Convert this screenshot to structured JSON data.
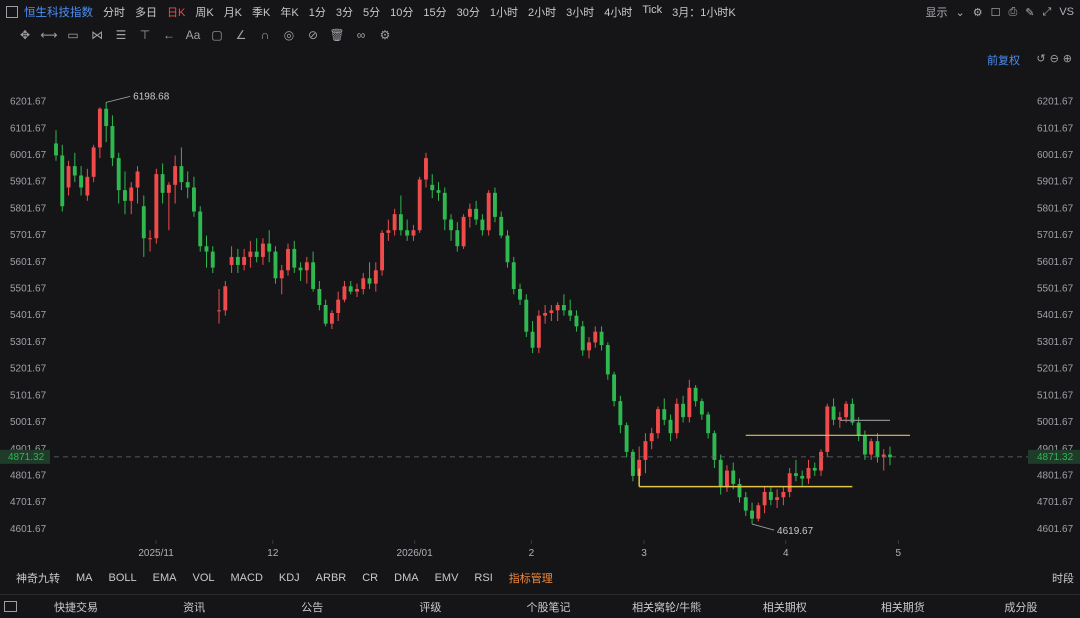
{
  "app": {
    "title": "恒生科技指数",
    "timeframes": [
      "分时",
      "多日",
      "日K",
      "周K",
      "月K",
      "季K",
      "年K",
      "1分",
      "3分",
      "5分",
      "10分",
      "15分",
      "30分",
      "1小时",
      "2小时",
      "3小时",
      "4小时",
      "Tick",
      "3月：1小时K"
    ],
    "active_timeframe": "日K",
    "display_label": "显示",
    "right_icons": [
      "gear-icon",
      "window-icon",
      "camera-icon",
      "pen-icon",
      "fullscreen-icon",
      "compare-icon"
    ],
    "compare_label": "VS"
  },
  "toolbar": {
    "tools": [
      "crosshair-icon",
      "line-icon",
      "rect-icon",
      "pattern-icon",
      "fib-icon",
      "vertical-icon",
      "arrow-icon",
      "text-icon",
      "comment-icon",
      "eraser-icon",
      "magnet-icon",
      "eye-icon",
      "lock-icon",
      "trash-icon",
      "link-icon",
      "settings-icon"
    ],
    "text_tool_label": "Aa"
  },
  "restore_label": "前复权",
  "chart_data": {
    "type": "candlestick",
    "ylim": [
      4560,
      6290
    ],
    "yticks": [
      6201.67,
      6101.67,
      6001.67,
      5901.67,
      5801.67,
      5701.67,
      5601.67,
      5501.67,
      5401.67,
      5301.67,
      5201.67,
      5101.67,
      5001.67,
      4901.67,
      4801.67,
      4701.67,
      4601.67
    ],
    "current_price": 4871.32,
    "current_price_label": "4871.32",
    "xlabels": [
      "2025/11",
      "12",
      "2026/01",
      "2",
      "3",
      "4",
      "5"
    ],
    "annotations": [
      {
        "text": "6198.68",
        "value": 6198.68
      },
      {
        "text": "4619.67",
        "value": 4619.67
      }
    ],
    "colors": {
      "up": "#ef4b4b",
      "down": "#2eb84f",
      "current": "#2eb84f",
      "level": "#e0c34a"
    },
    "candles": [
      [
        6045,
        6095,
        5980,
        6000
      ],
      [
        6000,
        6040,
        5790,
        5810
      ],
      [
        5880,
        5980,
        5850,
        5960
      ],
      [
        5960,
        6010,
        5900,
        5925
      ],
      [
        5925,
        5960,
        5850,
        5880
      ],
      [
        5850,
        5950,
        5830,
        5920
      ],
      [
        5920,
        6040,
        5900,
        6030
      ],
      [
        6030,
        6180,
        5990,
        6175
      ],
      [
        6175,
        6200,
        6050,
        6110
      ],
      [
        6110,
        6150,
        5960,
        5990
      ],
      [
        5990,
        6010,
        5820,
        5870
      ],
      [
        5870,
        5940,
        5780,
        5830
      ],
      [
        5830,
        5900,
        5780,
        5880
      ],
      [
        5880,
        5960,
        5820,
        5940
      ],
      [
        5810,
        5850,
        5620,
        5690
      ],
      [
        5690,
        5720,
        5640,
        5690
      ],
      [
        5690,
        5950,
        5670,
        5930
      ],
      [
        5930,
        5970,
        5820,
        5860
      ],
      [
        5860,
        5900,
        5720,
        5890
      ],
      [
        5890,
        6000,
        5820,
        5960
      ],
      [
        5960,
        6030,
        5870,
        5900
      ],
      [
        5900,
        5940,
        5840,
        5880
      ],
      [
        5880,
        5920,
        5770,
        5790
      ],
      [
        5790,
        5810,
        5640,
        5660
      ],
      [
        5660,
        5700,
        5580,
        5640
      ],
      [
        5640,
        5660,
        5560,
        5580
      ],
      [
        5420,
        5500,
        5370,
        5420
      ],
      [
        5420,
        5530,
        5400,
        5510
      ],
      [
        5590,
        5660,
        5560,
        5620
      ],
      [
        5620,
        5650,
        5560,
        5590
      ],
      [
        5590,
        5650,
        5570,
        5620
      ],
      [
        5620,
        5680,
        5580,
        5640
      ],
      [
        5640,
        5690,
        5600,
        5620
      ],
      [
        5620,
        5690,
        5590,
        5670
      ],
      [
        5670,
        5720,
        5600,
        5640
      ],
      [
        5640,
        5660,
        5520,
        5540
      ],
      [
        5540,
        5590,
        5480,
        5570
      ],
      [
        5570,
        5670,
        5550,
        5650
      ],
      [
        5650,
        5680,
        5560,
        5580
      ],
      [
        5580,
        5600,
        5530,
        5570
      ],
      [
        5570,
        5620,
        5520,
        5600
      ],
      [
        5600,
        5640,
        5490,
        5500
      ],
      [
        5500,
        5530,
        5420,
        5440
      ],
      [
        5440,
        5460,
        5360,
        5370
      ],
      [
        5370,
        5420,
        5350,
        5410
      ],
      [
        5410,
        5490,
        5380,
        5460
      ],
      [
        5460,
        5530,
        5450,
        5510
      ],
      [
        5510,
        5530,
        5480,
        5490
      ],
      [
        5490,
        5520,
        5470,
        5500
      ],
      [
        5500,
        5560,
        5480,
        5540
      ],
      [
        5540,
        5600,
        5500,
        5520
      ],
      [
        5520,
        5600,
        5490,
        5570
      ],
      [
        5570,
        5720,
        5550,
        5710
      ],
      [
        5710,
        5760,
        5680,
        5720
      ],
      [
        5720,
        5800,
        5700,
        5780
      ],
      [
        5780,
        5850,
        5700,
        5720
      ],
      [
        5720,
        5760,
        5680,
        5700
      ],
      [
        5700,
        5740,
        5680,
        5720
      ],
      [
        5720,
        5920,
        5710,
        5910
      ],
      [
        5910,
        6010,
        5880,
        5990
      ],
      [
        5890,
        5930,
        5840,
        5870
      ],
      [
        5870,
        5900,
        5830,
        5860
      ],
      [
        5860,
        5880,
        5720,
        5760
      ],
      [
        5760,
        5780,
        5680,
        5720
      ],
      [
        5720,
        5750,
        5640,
        5660
      ],
      [
        5660,
        5780,
        5650,
        5770
      ],
      [
        5770,
        5820,
        5730,
        5800
      ],
      [
        5800,
        5830,
        5740,
        5760
      ],
      [
        5760,
        5780,
        5700,
        5720
      ],
      [
        5720,
        5870,
        5700,
        5860
      ],
      [
        5860,
        5880,
        5750,
        5770
      ],
      [
        5770,
        5790,
        5690,
        5700
      ],
      [
        5700,
        5720,
        5580,
        5600
      ],
      [
        5600,
        5620,
        5480,
        5500
      ],
      [
        5500,
        5520,
        5440,
        5460
      ],
      [
        5460,
        5480,
        5320,
        5340
      ],
      [
        5340,
        5380,
        5260,
        5280
      ],
      [
        5280,
        5420,
        5260,
        5400
      ],
      [
        5400,
        5440,
        5370,
        5410
      ],
      [
        5410,
        5440,
        5380,
        5420
      ],
      [
        5420,
        5450,
        5380,
        5440
      ],
      [
        5440,
        5480,
        5400,
        5420
      ],
      [
        5420,
        5460,
        5380,
        5400
      ],
      [
        5400,
        5420,
        5340,
        5360
      ],
      [
        5360,
        5380,
        5250,
        5270
      ],
      [
        5270,
        5320,
        5240,
        5300
      ],
      [
        5300,
        5360,
        5280,
        5340
      ],
      [
        5340,
        5360,
        5270,
        5290
      ],
      [
        5290,
        5300,
        5160,
        5180
      ],
      [
        5180,
        5190,
        5060,
        5080
      ],
      [
        5080,
        5100,
        4960,
        4990
      ],
      [
        4990,
        5000,
        4870,
        4890
      ],
      [
        4890,
        4900,
        4780,
        4800
      ],
      [
        4800,
        4910,
        4780,
        4860
      ],
      [
        4860,
        4960,
        4810,
        4930
      ],
      [
        4930,
        4980,
        4900,
        4960
      ],
      [
        4960,
        5060,
        4940,
        5050
      ],
      [
        5050,
        5090,
        4990,
        5010
      ],
      [
        5010,
        5030,
        4930,
        4960
      ],
      [
        4960,
        5090,
        4940,
        5070
      ],
      [
        5070,
        5100,
        5000,
        5020
      ],
      [
        5020,
        5160,
        5000,
        5130
      ],
      [
        5130,
        5140,
        5060,
        5080
      ],
      [
        5080,
        5090,
        5010,
        5030
      ],
      [
        5030,
        5040,
        4940,
        4960
      ],
      [
        4960,
        4970,
        4830,
        4860
      ],
      [
        4860,
        4880,
        4730,
        4760
      ],
      [
        4760,
        4840,
        4740,
        4820
      ],
      [
        4820,
        4850,
        4750,
        4770
      ],
      [
        4770,
        4790,
        4700,
        4720
      ],
      [
        4720,
        4740,
        4650,
        4670
      ],
      [
        4670,
        4700,
        4620,
        4640
      ],
      [
        4640,
        4700,
        4630,
        4690
      ],
      [
        4690,
        4760,
        4660,
        4740
      ],
      [
        4740,
        4760,
        4690,
        4710
      ],
      [
        4710,
        4750,
        4680,
        4720
      ],
      [
        4720,
        4760,
        4690,
        4740
      ],
      [
        4740,
        4830,
        4720,
        4810
      ],
      [
        4810,
        4860,
        4780,
        4800
      ],
      [
        4800,
        4820,
        4760,
        4790
      ],
      [
        4790,
        4860,
        4770,
        4830
      ],
      [
        4830,
        4850,
        4800,
        4820
      ],
      [
        4820,
        4900,
        4800,
        4890
      ],
      [
        4890,
        5070,
        4870,
        5060
      ],
      [
        5060,
        5090,
        4990,
        5010
      ],
      [
        5010,
        5040,
        4980,
        5020
      ],
      [
        5020,
        5080,
        5000,
        5070
      ],
      [
        5070,
        5090,
        4990,
        5000
      ],
      [
        5000,
        5020,
        4930,
        4950
      ],
      [
        4950,
        4970,
        4860,
        4880
      ],
      [
        4880,
        4940,
        4860,
        4930
      ],
      [
        4930,
        4960,
        4850,
        4870
      ],
      [
        4870,
        4900,
        4820,
        4880
      ],
      [
        4880,
        4910,
        4840,
        4870
      ]
    ]
  },
  "indicators": [
    "神奇九转",
    "MA",
    "BOLL",
    "EMA",
    "VOL",
    "MACD",
    "KDJ",
    "ARBR",
    "CR",
    "DMA",
    "EMV",
    "RSI",
    "指标管理"
  ],
  "timeshare_label": "时段",
  "bottom_tabs": [
    "快捷交易",
    "资讯",
    "公告",
    "评级",
    "个股笔记",
    "相关窝轮/牛熊",
    "相关期权",
    "相关期货",
    "成分股"
  ]
}
